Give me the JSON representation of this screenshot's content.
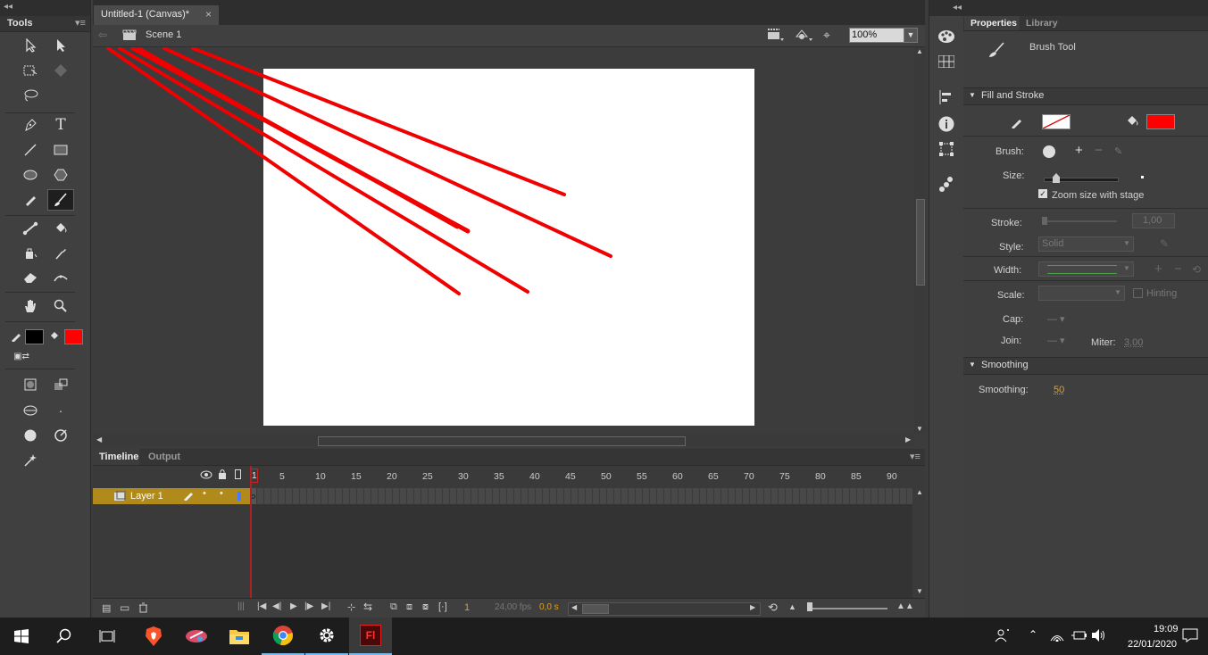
{
  "tools_panel": {
    "title": "Tools"
  },
  "document": {
    "tab_title": "Untitled-1 (Canvas)*",
    "tab_close": "×",
    "scene": "Scene 1",
    "zoom": "100%",
    "stage_color": "#ffffff",
    "stroke_color": "#ff0000"
  },
  "timeline": {
    "tabs": [
      "Timeline",
      "Output"
    ],
    "layer_name": "Layer 1",
    "frame_numbers": [
      "1",
      "5",
      "10",
      "15",
      "20",
      "25",
      "30",
      "35",
      "40",
      "45",
      "50",
      "55",
      "60",
      "65",
      "70",
      "75",
      "80",
      "85",
      "90"
    ],
    "current_frame": "1",
    "fps": "24,00 fps",
    "time": "0,0 s"
  },
  "properties": {
    "tabs": [
      "Properties",
      "Library"
    ],
    "tool_name": "Brush Tool",
    "fill_stroke_header": "Fill and Stroke",
    "fill_color": "#ff0000",
    "brush_label": "Brush:",
    "size_label": "Size:",
    "size_value": 0.12,
    "zoom_size_label": "Zoom size with stage",
    "stroke_label": "Stroke:",
    "stroke_value": "1,00",
    "style_label": "Style:",
    "style_value": "Solid",
    "width_label": "Width:",
    "scale_label": "Scale:",
    "hinting_label": "Hinting",
    "cap_label": "Cap:",
    "join_label": "Join:",
    "miter_label": "Miter:",
    "miter_value": "3,00",
    "smoothing_header": "Smoothing",
    "smoothing_label": "Smoothing:",
    "smoothing_value": "50"
  },
  "taskbar": {
    "time": "19:09",
    "date": "22/01/2020",
    "apps": [
      "start-icon",
      "search-icon",
      "task-view-icon",
      "brave-icon",
      "snipping-icon",
      "file-explorer-icon",
      "chrome-icon",
      "settings-icon",
      "flash-icon"
    ]
  }
}
